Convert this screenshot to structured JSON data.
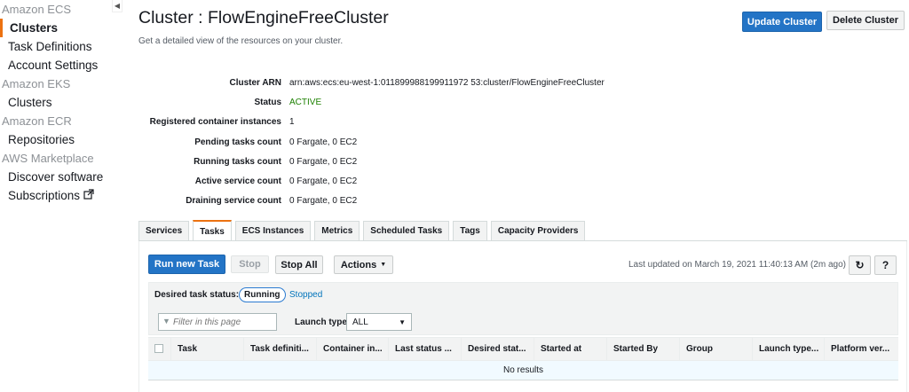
{
  "sidebar": {
    "sections": [
      {
        "group": "Amazon ECS",
        "items": [
          {
            "label": "Clusters",
            "active": true
          },
          {
            "label": "Task Definitions"
          },
          {
            "label": "Account Settings"
          }
        ]
      },
      {
        "group": "Amazon EKS",
        "items": [
          {
            "label": "Clusters"
          }
        ]
      },
      {
        "group": "Amazon ECR",
        "items": [
          {
            "label": "Repositories"
          }
        ]
      },
      {
        "group": "AWS Marketplace",
        "items": [
          {
            "label": "Discover software"
          },
          {
            "label": "Subscriptions",
            "icon": "external-link-icon"
          }
        ]
      }
    ],
    "collapse_glyph": "◀"
  },
  "header": {
    "title": "Cluster : FlowEngineFreeCluster",
    "subtitle": "Get a detailed view of the resources on your cluster.",
    "update_label": "Update Cluster",
    "delete_label": "Delete Cluster"
  },
  "details": [
    {
      "label": "Cluster ARN",
      "value": "arn:aws:ecs:eu-west-1:011899988199911972 53:cluster/FlowEngineFreeCluster"
    },
    {
      "label": "Status",
      "value": "ACTIVE",
      "status": true
    },
    {
      "label": "Registered container instances",
      "value": "1"
    },
    {
      "label": "Pending tasks count",
      "value": "0 Fargate, 0 EC2"
    },
    {
      "label": "Running tasks count",
      "value": "0 Fargate, 0 EC2"
    },
    {
      "label": "Active service count",
      "value": "0 Fargate, 0 EC2"
    },
    {
      "label": "Draining service count",
      "value": "0 Fargate, 0 EC2"
    }
  ],
  "tabs": [
    {
      "label": "Services"
    },
    {
      "label": "Tasks",
      "active": true
    },
    {
      "label": "ECS Instances"
    },
    {
      "label": "Metrics"
    },
    {
      "label": "Scheduled Tasks"
    },
    {
      "label": "Tags"
    },
    {
      "label": "Capacity Providers"
    }
  ],
  "toolbar": {
    "run_label": "Run new Task",
    "stop_label": "Stop",
    "stopall_label": "Stop All",
    "actions_label": "Actions",
    "last_updated": "Last updated on March 19, 2021 11:40:13 AM (2m ago)",
    "refresh_glyph": "↻",
    "help_glyph": "?"
  },
  "filters": {
    "desired_label": "Desired task status:",
    "running_label": "Running",
    "stopped_label": "Stopped",
    "filter_placeholder": "Filter in this page",
    "launch_type_label": "Launch type",
    "launch_type_value": "ALL"
  },
  "table": {
    "columns": [
      "Task",
      "Task definiti...",
      "Container in...",
      "Last status ...",
      "Desired stat...",
      "Started at",
      "Started By",
      "Group",
      "Launch type...",
      "Platform ver..."
    ],
    "empty_text": "No results"
  },
  "colors": {
    "accent": "#ec7211",
    "primary": "#2374c6",
    "status_active": "#1d8102",
    "link": "#0073bb"
  }
}
